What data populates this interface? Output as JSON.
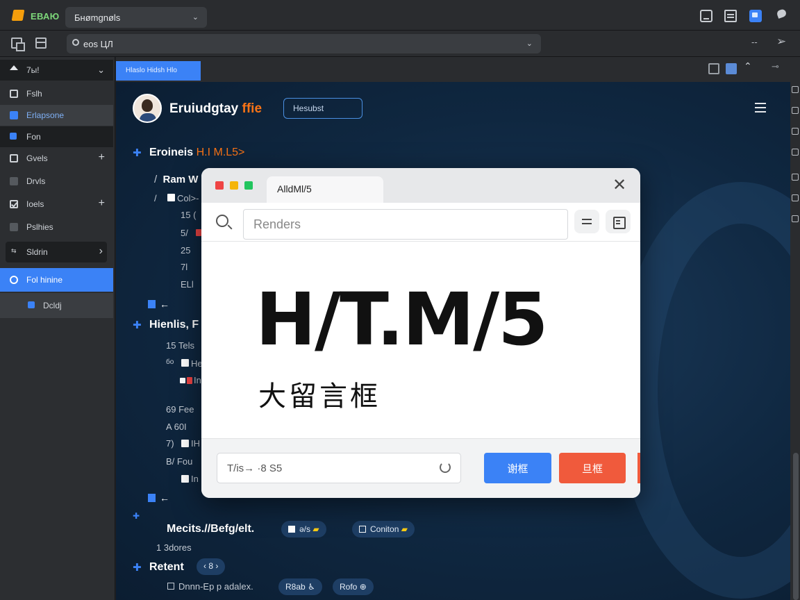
{
  "titlebar": {
    "app_name": "ЕВАЮ",
    "tab_label": "Бнømgnøls"
  },
  "addressbar": {
    "url": "eos  ЦЛ",
    "right_label": "--"
  },
  "sidebar": {
    "items": [
      {
        "label": "7ы!",
        "trail": "⌄"
      },
      {
        "label": "Fslh",
        "trail": ""
      },
      {
        "label": "Erlapsone",
        "trail": ""
      },
      {
        "label": "Fon",
        "trail": ""
      },
      {
        "label": "Gvels",
        "trail": "+"
      },
      {
        "label": "Drvls",
        "trail": ""
      },
      {
        "label": "Ioels",
        "trail": "+"
      },
      {
        "label": "Pslhies",
        "trail": ""
      },
      {
        "label": "Sldrin",
        "trail": "›"
      },
      {
        "label": "Fol hinine",
        "trail": ""
      },
      {
        "label": "Dcldj",
        "trail": ""
      }
    ]
  },
  "main": {
    "tab_label": "Hlaslo Hidsh Hlo",
    "site_title": "Eruiudgtay",
    "site_title_accent": "ffie",
    "header_button": "Hesubst",
    "heading1": "Eroineis",
    "heading1_accent": "H.I M.L5>",
    "code_lines": [
      {
        "prefix": "/",
        "text": "Ram W"
      },
      {
        "prefix": "/",
        "text": "Col>-"
      },
      {
        "prefix": "",
        "text": "15  ("
      },
      {
        "prefix": "",
        "text": "5/"
      },
      {
        "prefix": "",
        "text": "25"
      },
      {
        "prefix": "",
        "text": "7l"
      },
      {
        "prefix": "",
        "text": "ELl"
      }
    ],
    "heading2": "Hienlis, F",
    "sub_lines": [
      {
        "prefix": "15",
        "text": "Tels"
      },
      {
        "prefix": "бо",
        "text": "He"
      },
      {
        "prefix": "",
        "text": "In"
      },
      {
        "prefix": "69",
        "text": "Fee"
      },
      {
        "prefix": "A",
        "text": "60I"
      },
      {
        "prefix": "7)",
        "text": "IH"
      },
      {
        "prefix": "B/",
        "text": "Fou"
      },
      {
        "prefix": "",
        "text": "In"
      }
    ],
    "meta_line": "Mecits.//Befg/elt.",
    "pill1": "ə/s",
    "pill2": "Coniton",
    "meta_sub": "1  3dores",
    "recent_label": "Retent",
    "recent_pill": "‹ 8 ›",
    "bottom_line": "Dnnn-Ep  p  adalex.",
    "pill3": "R8ab",
    "pill4": "Rofo"
  },
  "modal": {
    "tab_title": "AlldMl/5",
    "search_placeholder": "Renders",
    "big_title": "H/T.M/5",
    "big_subtitle": "大留言框",
    "footer_input": "T/is→ ·8 S5",
    "primary_button": "谢框",
    "secondary_button": "旦框"
  },
  "colors": {
    "accent_blue": "#3b82f6",
    "accent_orange": "#f97316",
    "danger": "#f05a3c"
  }
}
